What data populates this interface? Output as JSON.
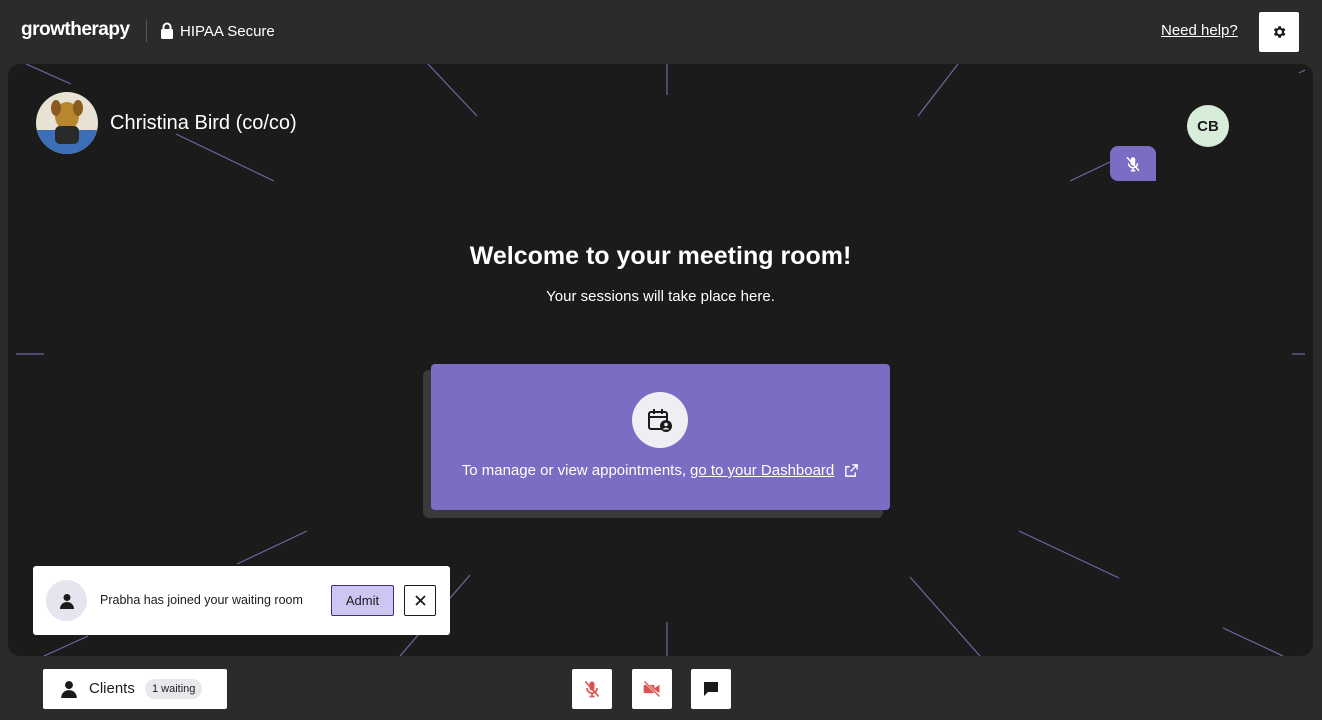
{
  "header": {
    "logo": "growtherapy",
    "security_label": "HIPAA Secure",
    "security_icon": "lock-icon",
    "help_link": "Need help?",
    "settings_icon": "gear-icon"
  },
  "room": {
    "participant": {
      "name": "Christina Bird (co/co)",
      "avatar": "dog-photo"
    },
    "self_initials": "CB",
    "self_muted_icon": "mic-off-icon",
    "welcome_title": "Welcome to your meeting room!",
    "welcome_subtitle": "Your sessions will take place here.",
    "card": {
      "icon": "calendar-user-icon",
      "text": "To manage or view appointments,",
      "link": "go to your Dashboard",
      "link_icon": "external-link-icon"
    }
  },
  "notification": {
    "message": "Prabha has joined your waiting room",
    "admit_label": "Admit",
    "avatar_icon": "person-icon",
    "dismiss_icon": "close-icon"
  },
  "bottom_bar": {
    "clients_label": "Clients",
    "waiting_badge": "1 waiting",
    "controls": [
      "mic-off-icon",
      "camera-off-icon",
      "chat-icon"
    ]
  },
  "colors": {
    "background": "#2b2b2b",
    "room_background": "#1b1b1b",
    "accent_purple": "#7b6cc4",
    "admit_background": "#cdc6f2",
    "initials_background": "#d7ecd9"
  }
}
